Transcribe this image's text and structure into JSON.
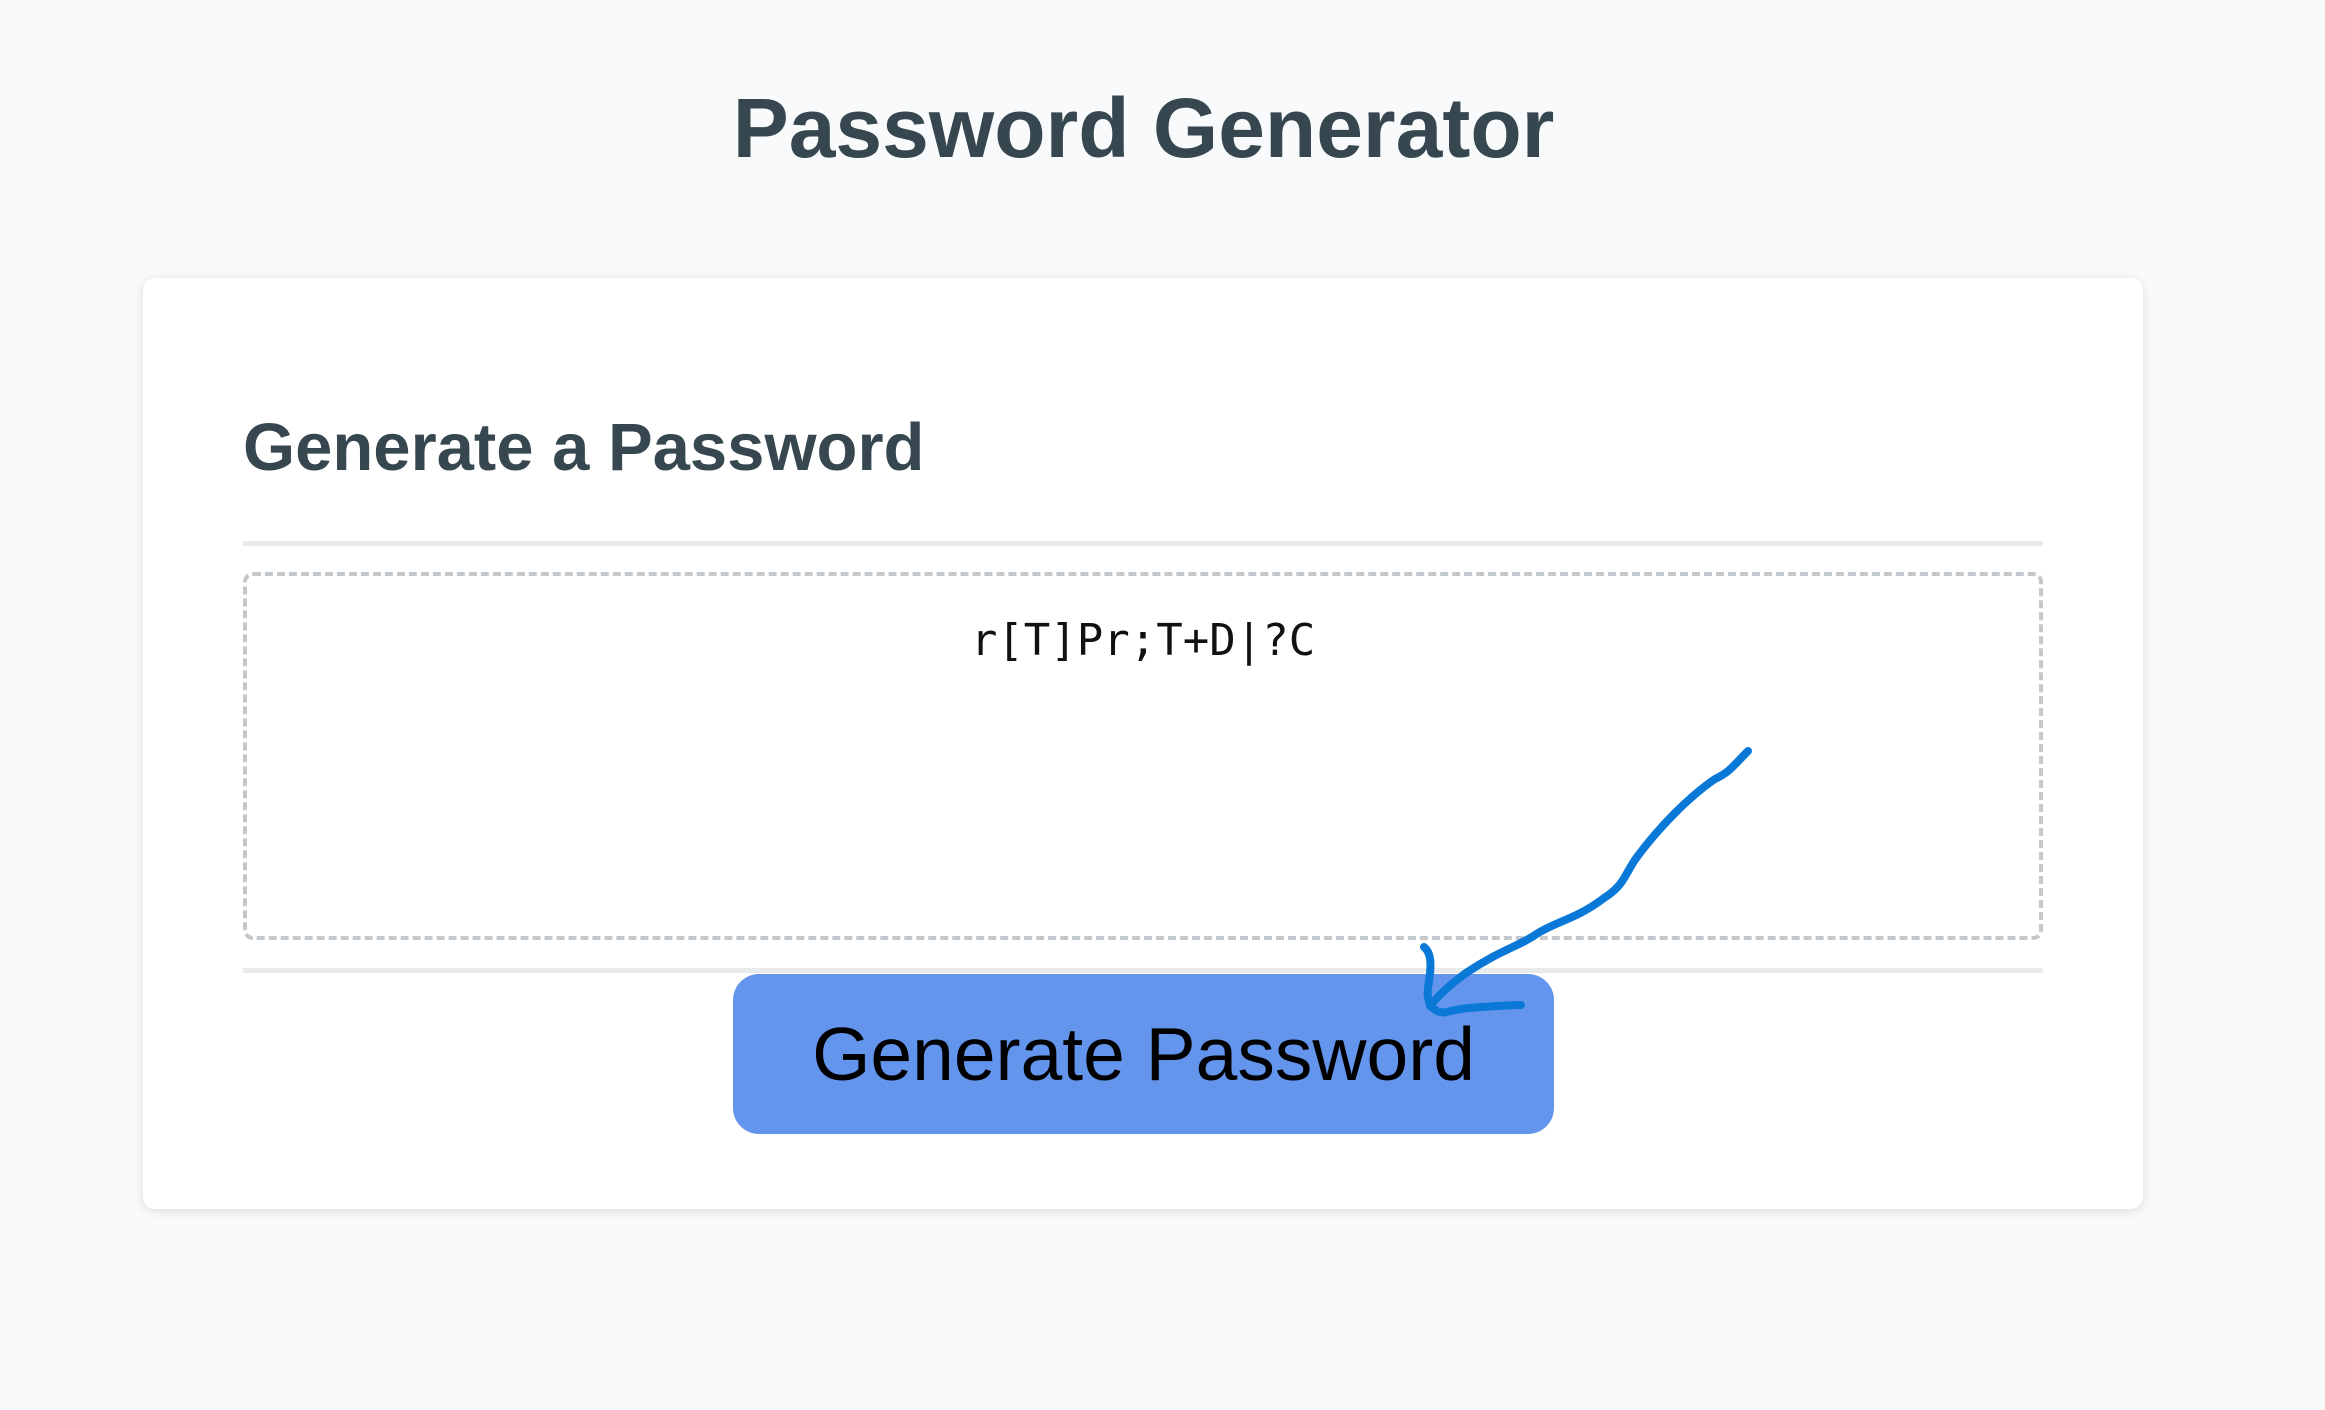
{
  "header": {
    "title": "Password Generator"
  },
  "card": {
    "title": "Generate a Password",
    "password_value": "r[T]Pr;T+D|?C",
    "generate_label": "Generate Password"
  },
  "colors": {
    "background": "#f9fafb",
    "heading": "#37474f",
    "button": "#6495ed",
    "annotation": "#0a78d7"
  },
  "annotation": {
    "icon": "hand-drawn-arrow-icon"
  }
}
